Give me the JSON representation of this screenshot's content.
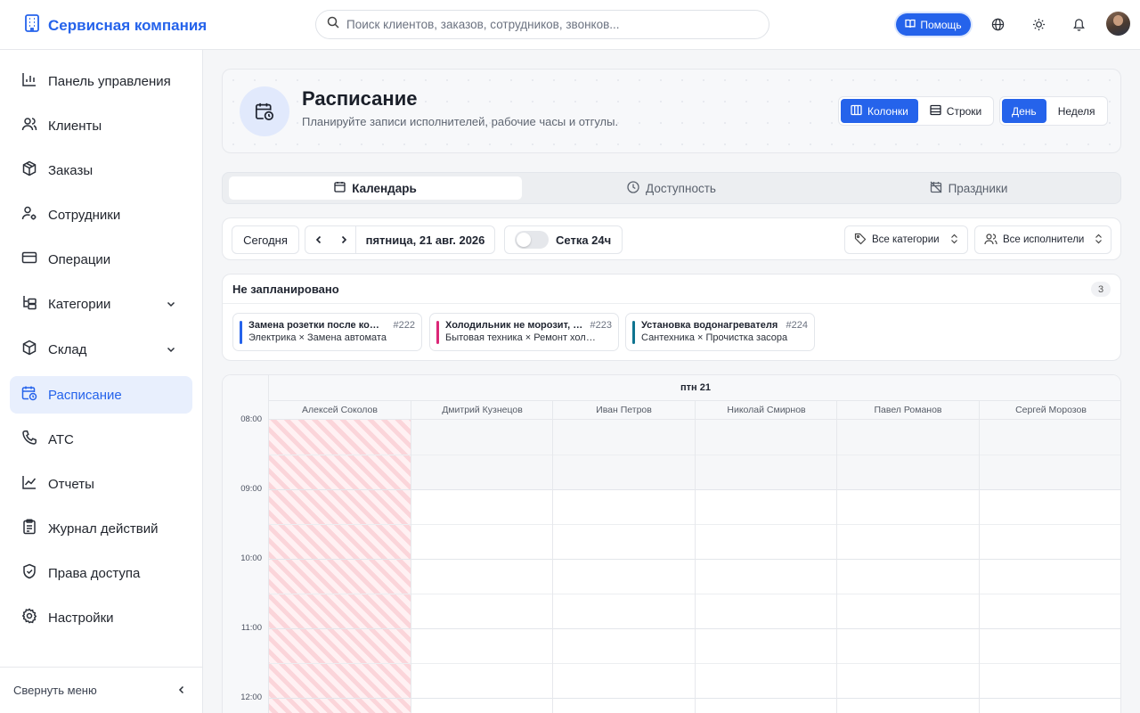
{
  "app": {
    "name": "Сервисная компания"
  },
  "search": {
    "placeholder": "Поиск клиентов, заказов, сотрудников, звонков..."
  },
  "topbar": {
    "help_label": "Помощь"
  },
  "sidebar": {
    "items": [
      {
        "label": "Панель управления",
        "icon": "bar-chart-icon"
      },
      {
        "label": "Клиенты",
        "icon": "users-icon"
      },
      {
        "label": "Заказы",
        "icon": "box-icon"
      },
      {
        "label": "Сотрудники",
        "icon": "user-gear-icon"
      },
      {
        "label": "Операции",
        "icon": "credit-card-icon"
      },
      {
        "label": "Категории",
        "icon": "tree-icon",
        "expandable": true
      },
      {
        "label": "Склад",
        "icon": "package-icon",
        "expandable": true
      },
      {
        "label": "Расписание",
        "icon": "calendar-clock-icon",
        "active": true
      },
      {
        "label": "АТС",
        "icon": "phone-icon"
      },
      {
        "label": "Отчеты",
        "icon": "line-chart-icon"
      },
      {
        "label": "Журнал действий",
        "icon": "clipboard-icon"
      },
      {
        "label": "Права доступа",
        "icon": "shield-icon"
      },
      {
        "label": "Настройки",
        "icon": "gear-icon"
      }
    ],
    "collapse_label": "Свернуть меню"
  },
  "header": {
    "title": "Расписание",
    "subtitle": "Планируйте записи исполнителей, рабочие часы и отгулы.",
    "layout_toggle": {
      "columns": "Колонки",
      "rows": "Строки",
      "selected": "columns"
    },
    "range_toggle": {
      "day": "День",
      "week": "Неделя",
      "selected": "day"
    }
  },
  "tabs": [
    {
      "label": "Календарь",
      "icon": "calendar-icon",
      "active": true
    },
    {
      "label": "Доступность",
      "icon": "clock-icon",
      "active": false
    },
    {
      "label": "Праздники",
      "icon": "calendar-off-icon",
      "active": false
    }
  ],
  "toolbar": {
    "today_label": "Сегодня",
    "date_label": "пятница, 21 авг. 2026",
    "grid_toggle_label": "Сетка 24ч",
    "grid_toggle_on": false,
    "category_filter": "Все категории",
    "performer_filter": "Все исполнители"
  },
  "unscheduled": {
    "title": "Не запланировано",
    "count": "3",
    "jobs": [
      {
        "title": "Замена розетки после короткого замыкания",
        "id": "#222",
        "subtitle": "Электрика × Замена автомата",
        "color": "#2563eb"
      },
      {
        "title": "Холодильник не морозит, нужна диагностика",
        "id": "#223",
        "subtitle": "Бытовая техника × Ремонт холодильника",
        "color": "#db2777"
      },
      {
        "title": "Установка водонагревателя",
        "id": "#224",
        "subtitle": "Сантехника × Прочистка засора",
        "color": "#0e7490"
      }
    ]
  },
  "calendar": {
    "day_header": "птн 21",
    "resources": [
      "Алексей Соколов",
      "Дмитрий Кузнецов",
      "Иван Петров",
      "Николай Смирнов",
      "Павел Романов",
      "Сергей Морозов"
    ],
    "times": [
      "08:00",
      "09:00",
      "10:00",
      "11:00",
      "12:00"
    ]
  },
  "colors": {
    "accent": "#2563eb",
    "unavailable_hatch": "#fbd5da"
  }
}
